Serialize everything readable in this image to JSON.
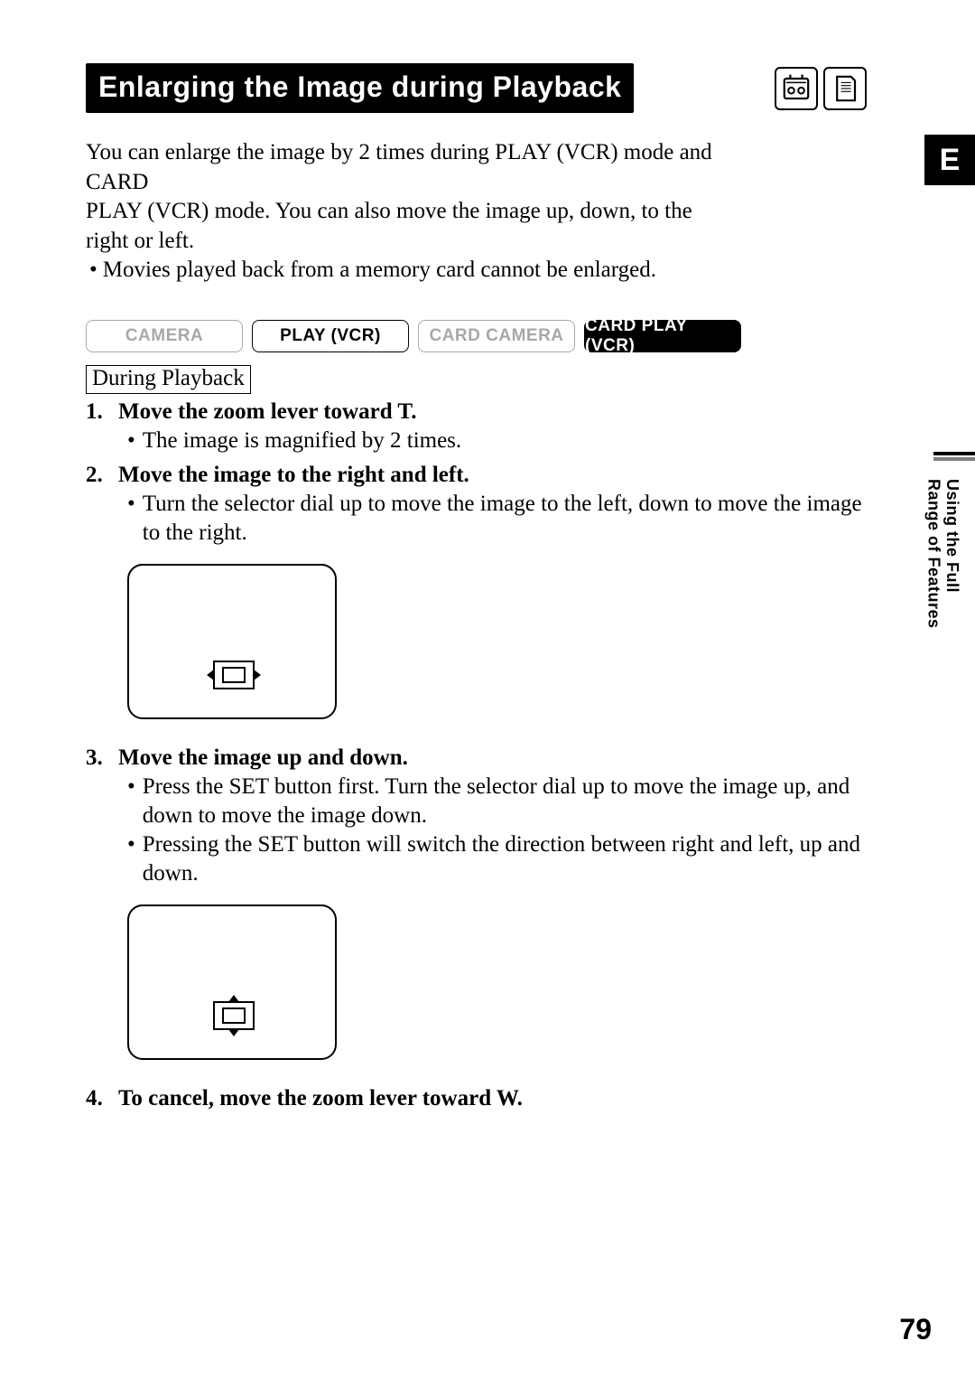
{
  "title": "Enlarging the Image during Playback",
  "lang_tab": "E",
  "intro_line1": "You can enlarge the image by 2 times during PLAY (VCR) mode and CARD",
  "intro_line2": "PLAY (VCR) mode. You can also move the image up, down, to the right or left.",
  "intro_bullet": "Movies played back from a memory card cannot be enlarged.",
  "modes": {
    "camera": "CAMERA",
    "play_vcr": "PLAY (VCR)",
    "card_camera": "CARD CAMERA",
    "card_play_vcr": "CARD PLAY (VCR)"
  },
  "during_playback": "During Playback",
  "steps": {
    "s1": "Move the zoom lever toward T.",
    "s1_b1": "The image is magnified by 2 times.",
    "s2": "Move the image to the right and left.",
    "s2_b1": "Turn the selector dial up to move the image to the left, down to move the image to the right.",
    "s3": "Move the image up and down.",
    "s3_b1": "Press the SET button first.  Turn the selector dial up to move the image up, and down to move the image down.",
    "s3_b2": "Pressing the SET button will switch the direction between right and left, up and down.",
    "s4": "To cancel, move the zoom lever toward W."
  },
  "side_text_line1": "Using the Full",
  "side_text_line2": "Range of Features",
  "page_number": "79"
}
